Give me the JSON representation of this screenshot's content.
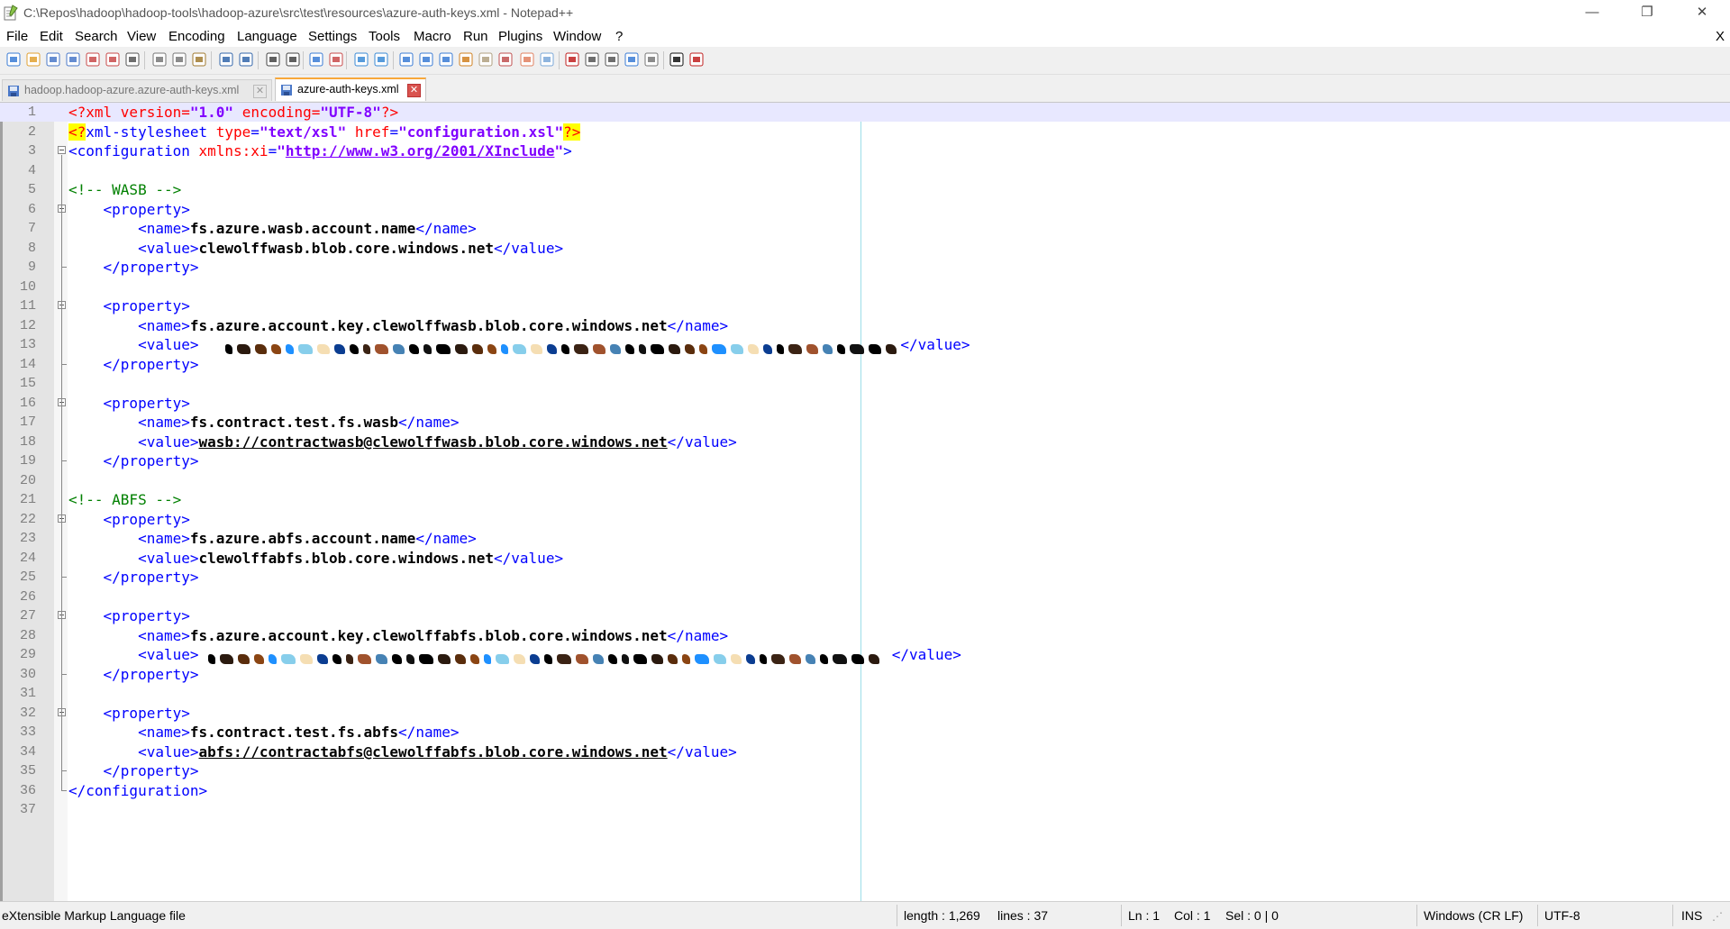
{
  "window": {
    "title": "C:\\Repos\\hadoop\\hadoop-tools\\hadoop-azure\\src\\test\\resources\\azure-auth-keys.xml - Notepad++",
    "minimize": "—",
    "restore": "❐",
    "close": "✕"
  },
  "menu": {
    "items": [
      "File",
      "Edit",
      "Search",
      "View",
      "Encoding",
      "Language",
      "Settings",
      "Tools",
      "Macro",
      "Run",
      "Plugins",
      "Window",
      "?"
    ],
    "close_doc": "X"
  },
  "toolbar": {
    "icons": [
      "new-file-icon",
      "open-file-icon",
      "save-icon",
      "save-all-icon",
      "close-icon",
      "close-all-icon",
      "print-icon",
      "cut-icon",
      "copy-icon",
      "paste-icon",
      "undo-icon",
      "redo-icon",
      "find-icon",
      "replace-icon",
      "zoom-in-icon",
      "zoom-out-icon",
      "sync-vertical-icon",
      "sync-horizontal-icon",
      "word-wrap-icon",
      "show-all-chars-icon",
      "indent-guide-icon",
      "user-defined-language-icon",
      "doc-map-icon",
      "function-list-icon",
      "folder-as-workspace-icon",
      "monitoring-icon",
      "record-macro-icon",
      "stop-macro-icon",
      "play-macro-icon",
      "run-macro-multiple-icon",
      "save-macro-icon",
      "jslint-icon",
      "spell-check-icon"
    ]
  },
  "tabs": [
    {
      "label": "hadoop.hadoop-azure.azure-auth-keys.xml",
      "active": false
    },
    {
      "label": "azure-auth-keys.xml",
      "active": true
    }
  ],
  "editor": {
    "lines": [
      {
        "n": "1",
        "fold": null,
        "indent": 0,
        "tokens": [
          [
            "pi",
            "<?xml "
          ],
          [
            "attr",
            "version"
          ],
          [
            "pi",
            "="
          ],
          [
            "val",
            "\"1.0\""
          ],
          [
            "pi",
            " "
          ],
          [
            "attr",
            "encoding"
          ],
          [
            "pi",
            "="
          ],
          [
            "val",
            "\"UTF-8\""
          ],
          [
            "pi",
            "?>"
          ]
        ]
      },
      {
        "n": "2",
        "fold": null,
        "indent": 0,
        "tokens": [
          [
            "hl",
            "<?"
          ],
          [
            "tag",
            "xml-stylesheet "
          ],
          [
            "attr",
            "type"
          ],
          [
            "tag",
            "="
          ],
          [
            "val",
            "\"text/xsl\""
          ],
          [
            "tag",
            " "
          ],
          [
            "attr",
            "href"
          ],
          [
            "tag",
            "="
          ],
          [
            "val",
            "\"configuration.xsl\""
          ],
          [
            "hl",
            "?>"
          ]
        ]
      },
      {
        "n": "3",
        "fold": "open",
        "indent": 0,
        "tokens": [
          [
            "tag",
            "<configuration "
          ],
          [
            "attr",
            "xmlns:xi"
          ],
          [
            "tag",
            "="
          ],
          [
            "val",
            "\""
          ],
          [
            "url",
            "http://www.w3.org/2001/XInclude"
          ],
          [
            "val",
            "\""
          ],
          [
            "tag",
            ">"
          ]
        ]
      },
      {
        "n": "4",
        "fold": null,
        "indent": 0,
        "tokens": []
      },
      {
        "n": "5",
        "fold": null,
        "indent": 0,
        "tokens": [
          [
            "cmt",
            "<!-- WASB -->"
          ]
        ]
      },
      {
        "n": "6",
        "fold": "open",
        "indent": 4,
        "tokens": [
          [
            "tag",
            "<property>"
          ]
        ]
      },
      {
        "n": "7",
        "fold": null,
        "indent": 8,
        "tokens": [
          [
            "tag",
            "<name>"
          ],
          [
            "txt",
            "fs.azure.wasb.account.name"
          ],
          [
            "tag",
            "</name>"
          ]
        ]
      },
      {
        "n": "8",
        "fold": null,
        "indent": 8,
        "tokens": [
          [
            "tag",
            "<value>"
          ],
          [
            "txt",
            "clewolffwasb.blob.core.windows.net"
          ],
          [
            "tag",
            "</value>"
          ]
        ]
      },
      {
        "n": "9",
        "fold": "end",
        "indent": 4,
        "tokens": [
          [
            "tag",
            "</property>"
          ]
        ]
      },
      {
        "n": "10",
        "fold": null,
        "indent": 0,
        "tokens": []
      },
      {
        "n": "11",
        "fold": "open",
        "indent": 4,
        "tokens": [
          [
            "tag",
            "<property>"
          ]
        ]
      },
      {
        "n": "12",
        "fold": null,
        "indent": 8,
        "tokens": [
          [
            "tag",
            "<name>"
          ],
          [
            "txt",
            "fs.azure.account.key.clewolffwasb.blob.core.windows.net"
          ],
          [
            "tag",
            "</name>"
          ]
        ]
      },
      {
        "n": "13",
        "fold": null,
        "indent": 8,
        "tokens": [
          [
            "tag",
            "<value>"
          ],
          [
            "redact",
            "   "
          ],
          [
            "tag",
            "</value>"
          ]
        ]
      },
      {
        "n": "14",
        "fold": "end",
        "indent": 4,
        "tokens": [
          [
            "tag",
            "</property>"
          ]
        ]
      },
      {
        "n": "15",
        "fold": null,
        "indent": 0,
        "tokens": []
      },
      {
        "n": "16",
        "fold": "open",
        "indent": 4,
        "tokens": [
          [
            "tag",
            "<property>"
          ]
        ]
      },
      {
        "n": "17",
        "fold": null,
        "indent": 8,
        "tokens": [
          [
            "tag",
            "<name>"
          ],
          [
            "txt",
            "fs.contract.test.fs.wasb"
          ],
          [
            "tag",
            "</name>"
          ]
        ]
      },
      {
        "n": "18",
        "fold": null,
        "indent": 8,
        "tokens": [
          [
            "tag",
            "<value>"
          ],
          [
            "link",
            "wasb://contractwasb@clewolffwasb.blob.core.windows.net"
          ],
          [
            "tag",
            "</value>"
          ]
        ]
      },
      {
        "n": "19",
        "fold": "end",
        "indent": 4,
        "tokens": [
          [
            "tag",
            "</property>"
          ]
        ]
      },
      {
        "n": "20",
        "fold": null,
        "indent": 0,
        "tokens": []
      },
      {
        "n": "21",
        "fold": null,
        "indent": 0,
        "tokens": [
          [
            "cmt",
            "<!-- ABFS -->"
          ]
        ]
      },
      {
        "n": "22",
        "fold": "open",
        "indent": 4,
        "tokens": [
          [
            "tag",
            "<property>"
          ]
        ]
      },
      {
        "n": "23",
        "fold": null,
        "indent": 8,
        "tokens": [
          [
            "tag",
            "<name>"
          ],
          [
            "txt",
            "fs.azure.abfs.account.name"
          ],
          [
            "tag",
            "</name>"
          ]
        ]
      },
      {
        "n": "24",
        "fold": null,
        "indent": 8,
        "tokens": [
          [
            "tag",
            "<value>"
          ],
          [
            "txt",
            "clewolffabfs.blob.core.windows.net"
          ],
          [
            "tag",
            "</value>"
          ]
        ]
      },
      {
        "n": "25",
        "fold": "end",
        "indent": 4,
        "tokens": [
          [
            "tag",
            "</property>"
          ]
        ]
      },
      {
        "n": "26",
        "fold": null,
        "indent": 0,
        "tokens": []
      },
      {
        "n": "27",
        "fold": "open",
        "indent": 4,
        "tokens": [
          [
            "tag",
            "<property>"
          ]
        ]
      },
      {
        "n": "28",
        "fold": null,
        "indent": 8,
        "tokens": [
          [
            "tag",
            "<name>"
          ],
          [
            "txt",
            "fs.azure.account.key.clewolffabfs.blob.core.windows.net"
          ],
          [
            "tag",
            "</name>"
          ]
        ]
      },
      {
        "n": "29",
        "fold": null,
        "indent": 8,
        "tokens": [
          [
            "tag",
            "<value>"
          ],
          [
            "redact",
            " "
          ],
          [
            "tag",
            " </value>"
          ]
        ]
      },
      {
        "n": "30",
        "fold": "end",
        "indent": 4,
        "tokens": [
          [
            "tag",
            "</property>"
          ]
        ]
      },
      {
        "n": "31",
        "fold": null,
        "indent": 0,
        "tokens": []
      },
      {
        "n": "32",
        "fold": "open",
        "indent": 4,
        "tokens": [
          [
            "tag",
            "<property>"
          ]
        ]
      },
      {
        "n": "33",
        "fold": null,
        "indent": 8,
        "tokens": [
          [
            "tag",
            "<name>"
          ],
          [
            "txt",
            "fs.contract.test.fs.abfs"
          ],
          [
            "tag",
            "</name>"
          ]
        ]
      },
      {
        "n": "34",
        "fold": null,
        "indent": 8,
        "tokens": [
          [
            "tag",
            "<value>"
          ],
          [
            "link",
            "abfs://contractabfs@clewolffabfs.blob.core.windows.net"
          ],
          [
            "tag",
            "</value>"
          ]
        ]
      },
      {
        "n": "35",
        "fold": "end",
        "indent": 4,
        "tokens": [
          [
            "tag",
            "</property>"
          ]
        ]
      },
      {
        "n": "36",
        "fold": "close",
        "indent": 0,
        "tokens": [
          [
            "tag",
            "</configuration>"
          ]
        ]
      },
      {
        "n": "37",
        "fold": null,
        "indent": 0,
        "tokens": []
      }
    ],
    "redaction_colors": [
      "#000000",
      "#2b1a0f",
      "#5a2d0c",
      "#8b4513",
      "#1e90ff",
      "#87ceeb",
      "#f5deb3",
      "#0b3d91",
      "#000000",
      "#3b2314",
      "#a0522d",
      "#4682b4",
      "#000000",
      "#111111"
    ]
  },
  "status": {
    "filetype": "eXtensible Markup Language file",
    "length": "length : 1,269",
    "lines": "lines : 37",
    "ln": "Ln : 1",
    "col": "Col : 1",
    "sel": "Sel : 0 | 0",
    "eol": "Windows (CR LF)",
    "encoding": "UTF-8",
    "mode": "INS"
  }
}
